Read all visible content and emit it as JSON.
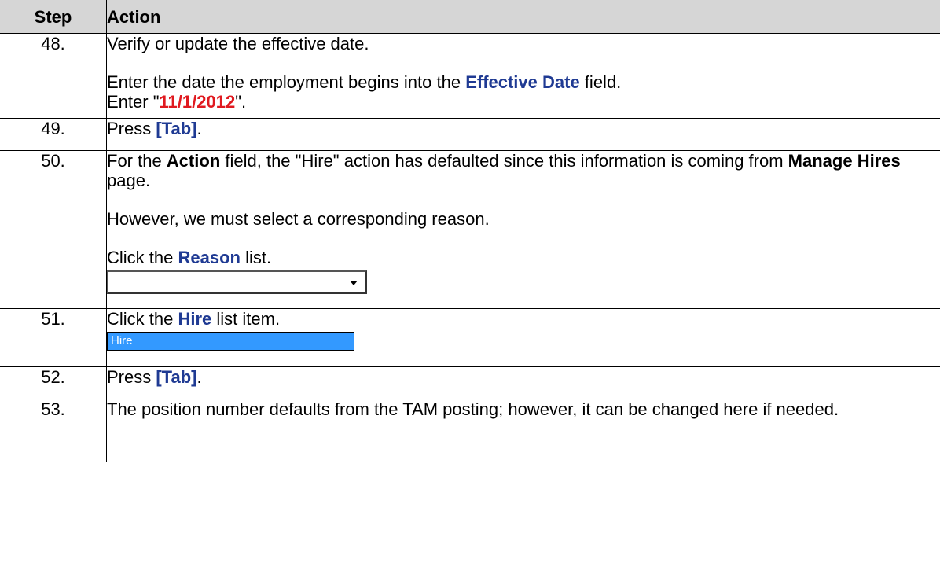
{
  "header": {
    "step": "Step",
    "action": "Action"
  },
  "rows": [
    {
      "step": "48.",
      "line1": "Verify or update the effective date.",
      "line2_pre": "Enter the date the employment begins into the ",
      "line2_field": "Effective Date",
      "line2_post": " field.",
      "line3_pre": "Enter \"",
      "line3_value": "11/1/2012",
      "line3_post": "\"."
    },
    {
      "step": "49.",
      "pre": "Press ",
      "key": "[Tab]",
      "post": "."
    },
    {
      "step": "50.",
      "p1_pre": "For the ",
      "p1_field": "Action",
      "p1_mid": " field, the \"Hire\" action has defaulted since this information is coming from ",
      "p1_page": "Manage Hires",
      "p1_post": " page.",
      "p2": "However, we must select a corresponding reason.",
      "p3_pre": "Click the ",
      "p3_field": "Reason",
      "p3_post": " list.",
      "select_value": ""
    },
    {
      "step": "51.",
      "pre": "Click the ",
      "item": "Hire",
      "post": " list item.",
      "list_item_text": "Hire"
    },
    {
      "step": "52.",
      "pre": "Press ",
      "key": "[Tab]",
      "post": "."
    },
    {
      "step": "53.",
      "text": "The position number defaults from the TAM posting; however, it can be changed here if needed."
    }
  ]
}
